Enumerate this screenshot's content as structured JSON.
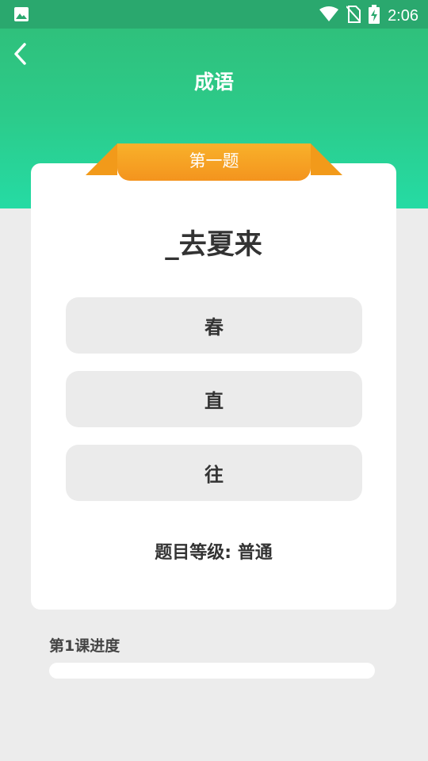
{
  "status_bar": {
    "time": "2:06",
    "icons": [
      "image-icon",
      "wifi-icon",
      "no-sim-icon",
      "battery-charging-icon"
    ]
  },
  "nav": {
    "title": "成语",
    "back_icon": "chevron-left-icon"
  },
  "card": {
    "ribbon_label": "第一题",
    "question": "_去夏来",
    "options": [
      "春",
      "直",
      "往"
    ],
    "level_text": "题目等级: 普通"
  },
  "progress": {
    "label": "第1课进度",
    "value": 0
  },
  "colors": {
    "header_top": "#30bd77",
    "header_bottom": "#25dba4",
    "ribbon": "#f4941e",
    "background": "#ececec"
  }
}
